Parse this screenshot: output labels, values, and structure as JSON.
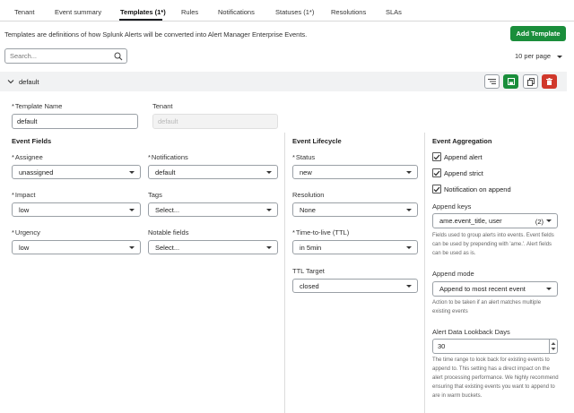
{
  "tabs": [
    {
      "label": "Tenant"
    },
    {
      "label": "Event summary"
    },
    {
      "label": "Templates (1*)"
    },
    {
      "label": "Rules"
    },
    {
      "label": "Notifications"
    },
    {
      "label": "Statuses (1*)"
    },
    {
      "label": "Resolutions"
    },
    {
      "label": "SLAs"
    }
  ],
  "active_tab": "Templates (1*)",
  "description": "Templates are definitions of how Splunk Alerts will be converted into Alert Manager Enterprise Events.",
  "add_button": "Add Template",
  "search_placeholder": "Search...",
  "per_page": "10 per page",
  "template": {
    "name": "default",
    "name_label": "Template Name",
    "name_value": "default",
    "tenant_label": "Tenant",
    "tenant_placeholder": "default"
  },
  "event_fields": {
    "header": "Event Fields",
    "assignee_label": "Assignee",
    "assignee_value": "unassigned",
    "notifications_label": "Notifications",
    "notifications_value": "default",
    "impact_label": "Impact",
    "impact_value": "low",
    "tags_label": "Tags",
    "tags_value": "Select...",
    "urgency_label": "Urgency",
    "urgency_value": "low",
    "notable_label": "Notable fields",
    "notable_value": "Select..."
  },
  "lifecycle": {
    "header": "Event Lifecycle",
    "status_label": "Status",
    "status_value": "new",
    "resolution_label": "Resolution",
    "resolution_value": "None",
    "ttl_label": "Time-to-live (TTL)",
    "ttl_value": "in 5min",
    "ttl_target_label": "TTL Target",
    "ttl_target_value": "closed"
  },
  "aggregation": {
    "header": "Event Aggregation",
    "checkboxes": [
      {
        "label": "Append alert",
        "checked": true
      },
      {
        "label": "Append strict",
        "checked": true
      },
      {
        "label": "Notification on append",
        "checked": true
      }
    ],
    "append_keys_label": "Append keys",
    "append_keys_value": "ame.event_title, user",
    "append_keys_count": "(2)",
    "append_keys_help": "Fields used to group alerts into events. Event fields can be used by prepending with 'ame.'. Alert fields can be used as is.",
    "append_mode_label": "Append mode",
    "append_mode_value": "Append to most recent event",
    "append_mode_help": "Action to be taken if an alert matches multiple existing events",
    "lookback_label": "Alert Data Lookback Days",
    "lookback_value": "30",
    "lookback_help": "The time range to look back for existing events to append to. This setting has a direct impact on the alert processing performance. We highly recommend ensuring that existing events you want to append to are in warm buckets."
  },
  "colors": {
    "primary_green": "#1a8e3b",
    "danger_red": "#d0382b",
    "bar_gray": "#f1f2f3"
  }
}
